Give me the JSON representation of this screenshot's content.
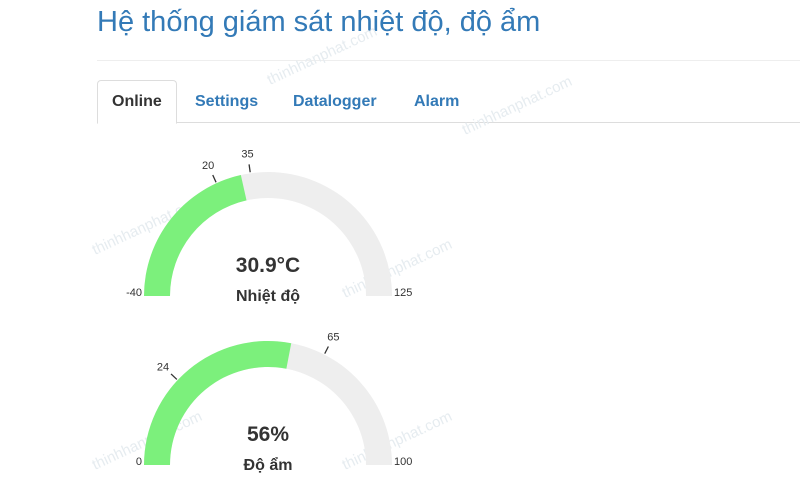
{
  "header": {
    "title": "Hệ thống giám sát nhiệt độ, độ ẩm"
  },
  "tabs": [
    {
      "label": "Online",
      "active": true
    },
    {
      "label": "Settings",
      "active": false
    },
    {
      "label": "Datalogger",
      "active": false
    },
    {
      "label": "Alarm",
      "active": false
    }
  ],
  "watermark": "thinhhanphat.com",
  "colors": {
    "title": "#337ab7",
    "tab_link": "#337ab7",
    "gauge_fill": "#7cf07c",
    "gauge_track": "#eeeeee",
    "value_text": "#333333"
  },
  "gauges": {
    "temperature": {
      "value_text": "30.9°C",
      "label": "Nhiệt độ",
      "value": 30.9,
      "min": -40,
      "max": 125,
      "min_label": "-40",
      "max_label": "125",
      "markers": [
        {
          "value": 20,
          "label": "20"
        },
        {
          "value": 35,
          "label": "35"
        }
      ]
    },
    "humidity": {
      "value_text": "56%",
      "label": "Độ ẩm",
      "value": 56,
      "min": 0,
      "max": 100,
      "min_label": "0",
      "max_label": "100",
      "markers": [
        {
          "value": 24,
          "label": "24"
        },
        {
          "value": 65,
          "label": "65"
        }
      ]
    }
  }
}
